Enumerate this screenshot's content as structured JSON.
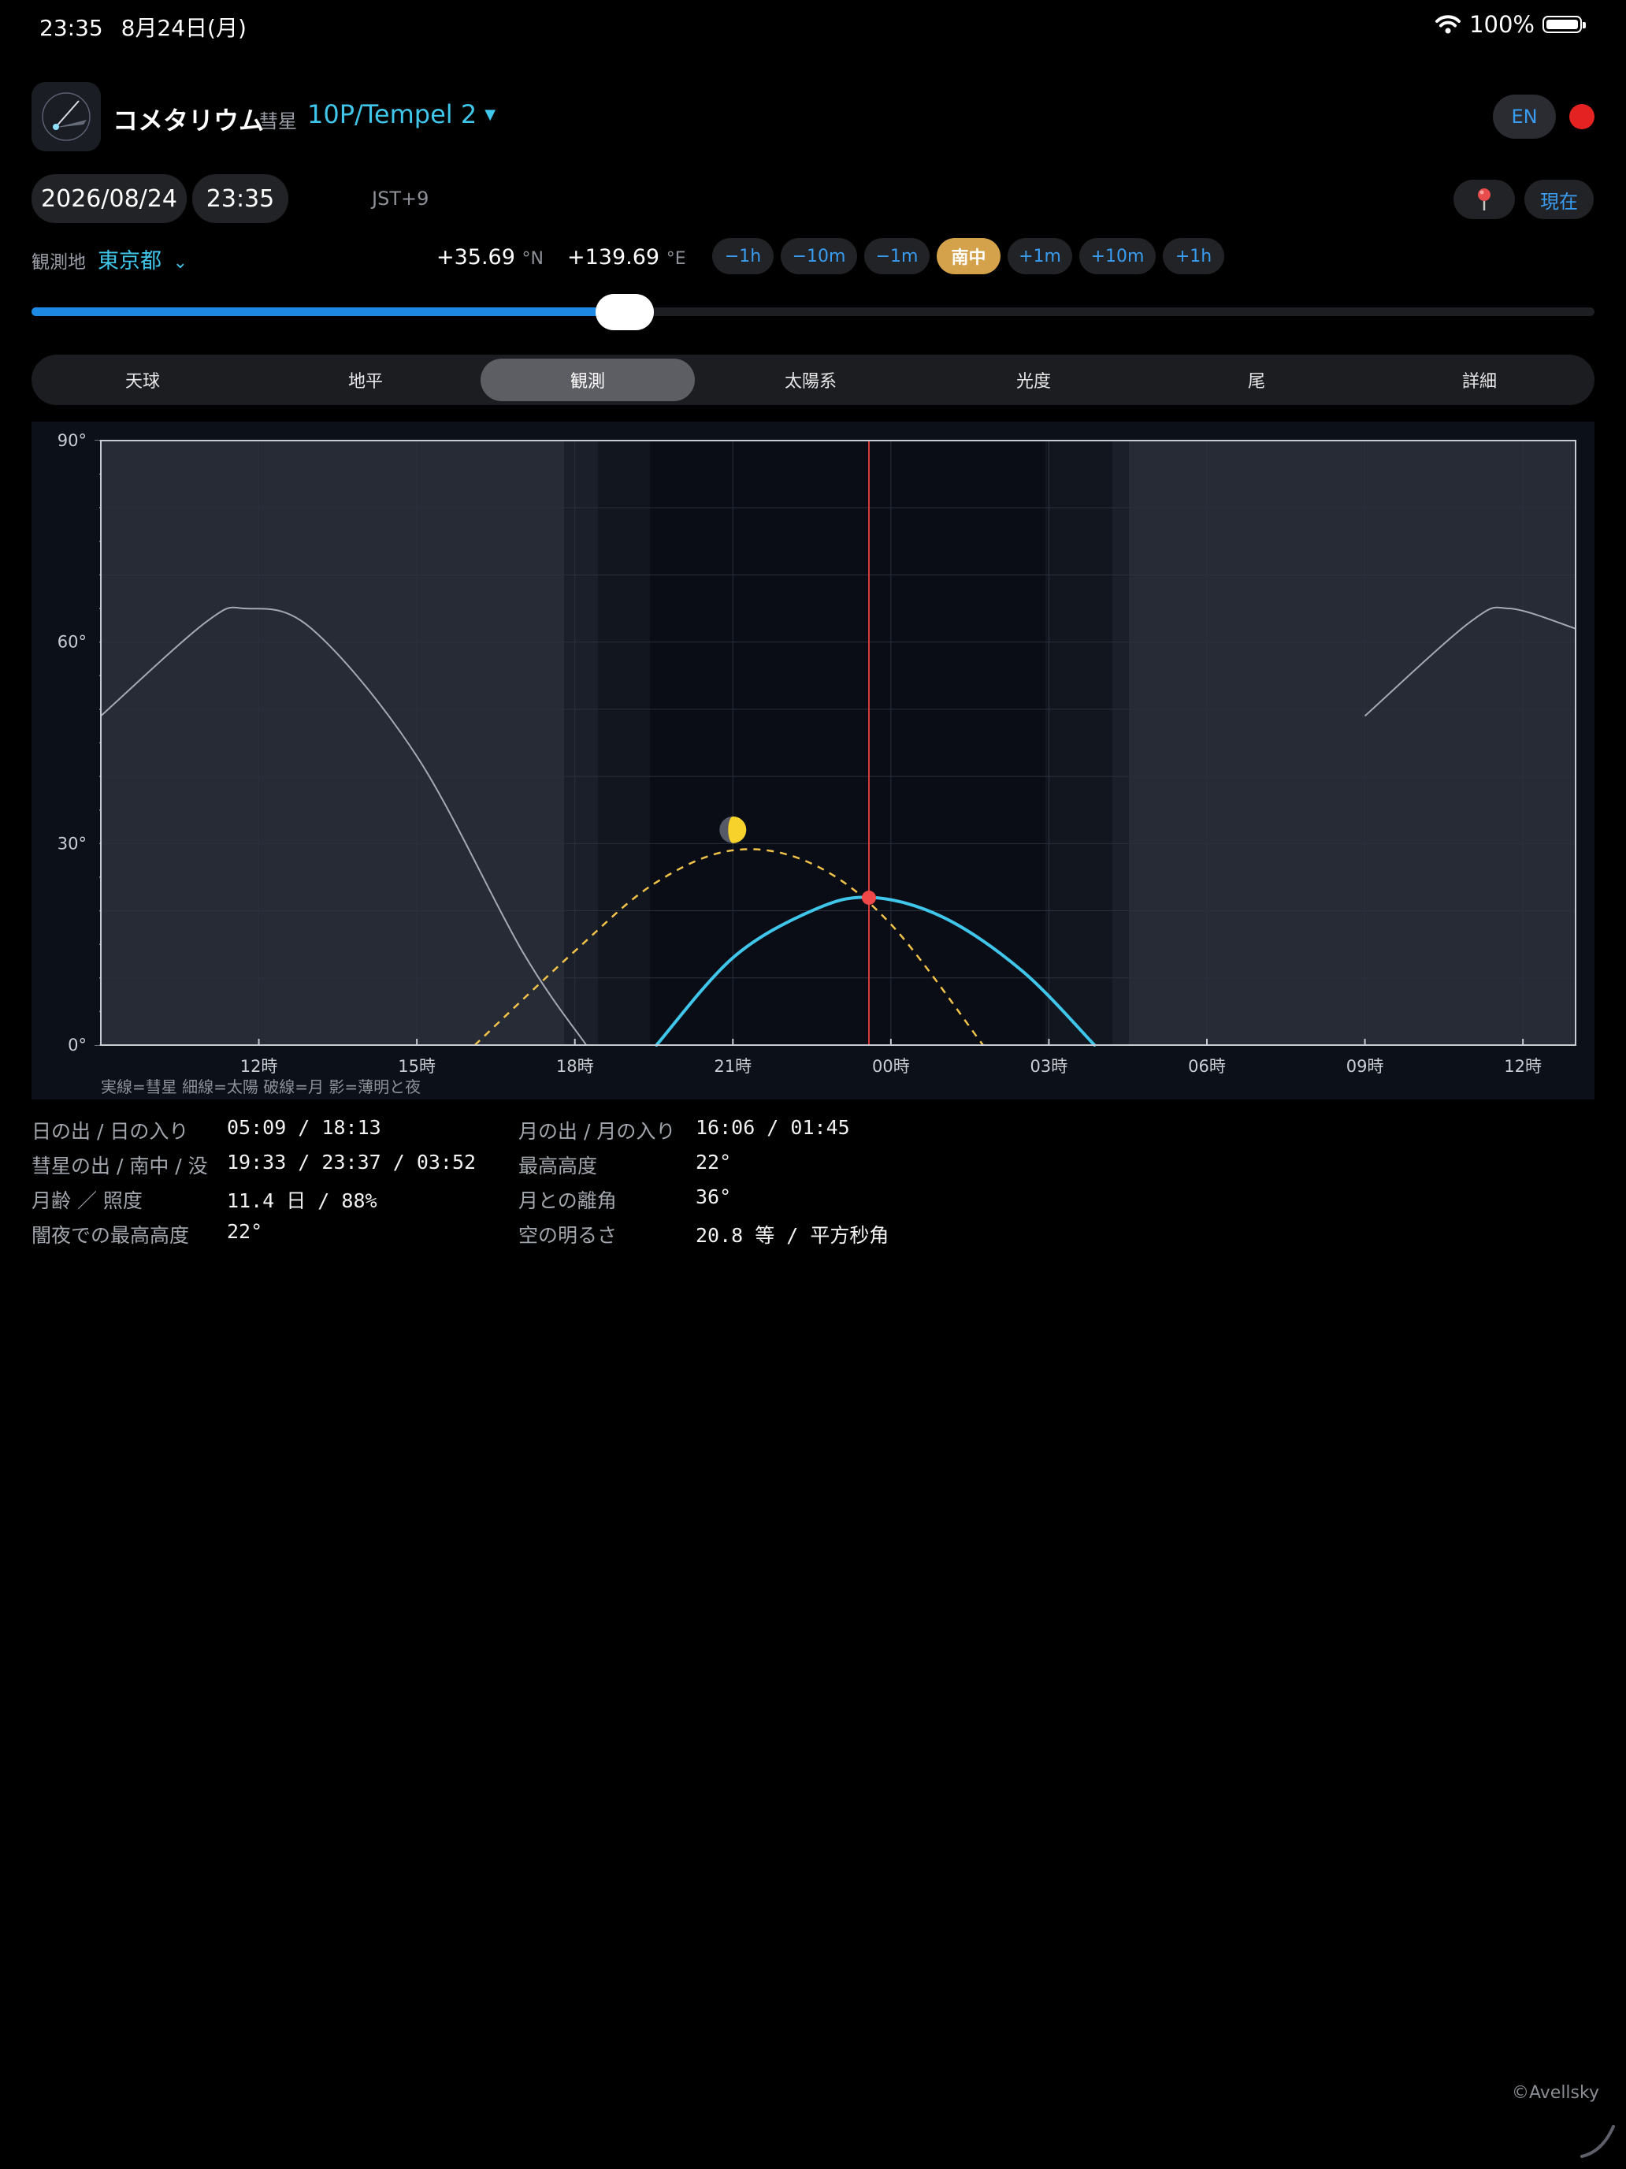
{
  "status": {
    "time": "23:35",
    "date": "8月24日(月)",
    "battery": "100%"
  },
  "header": {
    "app_name": "コメタリウム",
    "comet_label": "彗星",
    "comet": "10P/Tempel 2",
    "lang": "EN"
  },
  "datetime": {
    "date": "2026/08/24",
    "time": "23:35",
    "tz": "JST+9",
    "now_label": "現在"
  },
  "observer": {
    "label": "観測地",
    "city": "東京都",
    "lat": "+35.69",
    "lat_unit": "°N",
    "lon": "+139.69",
    "lon_unit": "°E"
  },
  "steps": [
    "−1h",
    "−10m",
    "−1m",
    "南中",
    "+1m",
    "+10m",
    "+1h"
  ],
  "time_slider": {
    "value_fraction": 0.39
  },
  "tabs": [
    "天球",
    "地平",
    "観測",
    "太陽系",
    "光度",
    "尾",
    "詳細"
  ],
  "active_tab": "観測",
  "chart_data": {
    "type": "line",
    "ylim": [
      0,
      90
    ],
    "y_ticks": [
      "0°",
      "30°",
      "60°",
      "90°"
    ],
    "x_ticks": [
      "12時",
      "15時",
      "18時",
      "21時",
      "00時",
      "03時",
      "06時",
      "09時",
      "12時"
    ],
    "legend": "実線=彗星  細線=太陽  破線=月  影=薄明と夜",
    "current_time": "23:35",
    "series": [
      {
        "name": "彗星",
        "x": [
          "19:33",
          "21:00",
          "22:30",
          "23:37",
          "01:00",
          "02:30",
          "03:52"
        ],
        "y": [
          0,
          13,
          20,
          22,
          19,
          11,
          0
        ]
      },
      {
        "name": "太陽",
        "x": [
          "09:00",
          "11:00",
          "11:45",
          "13:00",
          "15:00",
          "17:00",
          "18:13"
        ],
        "y": [
          49,
          63,
          65,
          62,
          43,
          14,
          0
        ]
      },
      {
        "name": "月",
        "x": [
          "16:06",
          "18:00",
          "19:30",
          "21:00",
          "22:30",
          "00:00",
          "01:45"
        ],
        "y": [
          0,
          14,
          24,
          29,
          27,
          18,
          0
        ]
      }
    ],
    "colors": {
      "comet": "#3fc6ea",
      "sun": "#a6a9b2",
      "moon": "#f0c24a",
      "now_line": "#d83a3a"
    }
  },
  "info": {
    "left": [
      {
        "label": "日の出 / 日の入り",
        "value": "05:09 / 18:13"
      },
      {
        "label": "彗星の出 / 南中 / 没",
        "value": "19:33 / 23:37 / 03:52"
      },
      {
        "label": "月齢 ／ 照度",
        "value": "11.4 日 / 88%"
      },
      {
        "label": "闇夜での最高高度",
        "value": "22°"
      }
    ],
    "right": [
      {
        "label": "月の出 / 月の入り",
        "value": "16:06 / 01:45"
      },
      {
        "label": "最高高度",
        "value": "22°"
      },
      {
        "label": "月との離角",
        "value": "36°"
      },
      {
        "label": "空の明るさ",
        "value": "20.8 等 / 平方秒角"
      }
    ]
  },
  "copyright": "©Avellsky"
}
